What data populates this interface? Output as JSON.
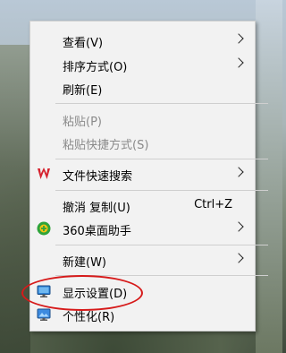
{
  "menu": {
    "items": [
      {
        "label": "查看(V)",
        "submenu": true
      },
      {
        "label": "排序方式(O)",
        "submenu": true
      },
      {
        "label": "刷新(E)"
      },
      {
        "label": "粘贴(P)",
        "disabled": true
      },
      {
        "label": "粘贴快捷方式(S)",
        "disabled": true
      },
      {
        "label": "文件快速搜索",
        "submenu": true,
        "icon": "wps-logo-icon"
      },
      {
        "label": "撤消 复制(U)",
        "shortcut": "Ctrl+Z"
      },
      {
        "label": "360桌面助手",
        "submenu": true,
        "icon": "360-assistant-icon"
      },
      {
        "label": "新建(W)",
        "submenu": true
      },
      {
        "label": "显示设置(D)",
        "icon": "display-settings-icon",
        "highlighted": true
      },
      {
        "label": "个性化(R)",
        "icon": "personalize-icon"
      }
    ]
  },
  "colors": {
    "menu_background": "#f2f2f2",
    "highlight_circle": "#d61a1a",
    "disabled_text": "#8a8a8a",
    "wps_red": "#d6232f",
    "green_360": "#2fa43a",
    "yellow_360": "#f3c312"
  }
}
